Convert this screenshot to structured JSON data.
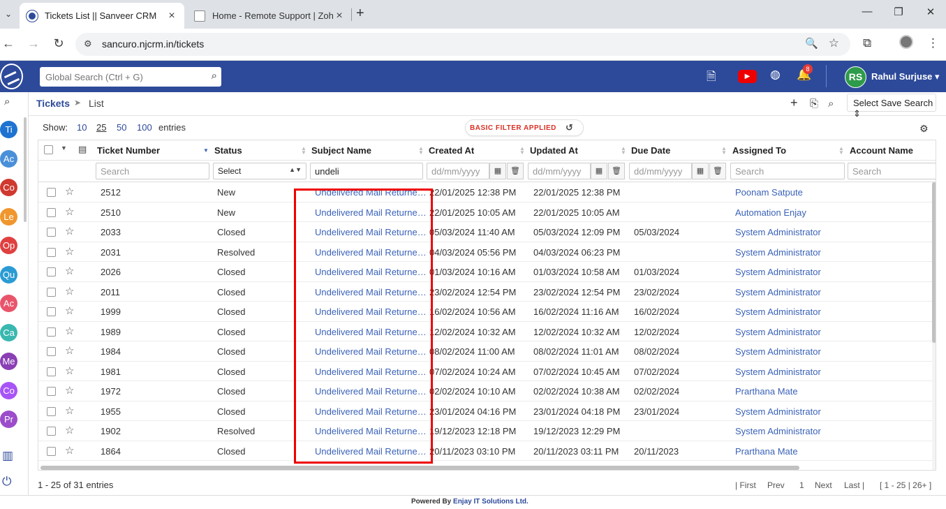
{
  "browser": {
    "tabs": [
      {
        "title": "Tickets List || Sanveer CRM",
        "active": true
      },
      {
        "title": "Home - Remote Support | Zoho",
        "active": false
      }
    ],
    "url": "sancuro.njcrm.in/tickets"
  },
  "header": {
    "search_placeholder": "Global Search (Ctrl + G)",
    "notification_count": "8",
    "youtube_label": "▶",
    "user_initials": "RS",
    "user_name": "Rahul Surjuse ▾"
  },
  "rail": {
    "modules": [
      {
        "abbr": "Ti",
        "color": "#1e73d1"
      },
      {
        "abbr": "Ac",
        "color": "#4a90d9"
      },
      {
        "abbr": "Co",
        "color": "#d0392f"
      },
      {
        "abbr": "Le",
        "color": "#f0962e"
      },
      {
        "abbr": "Op",
        "color": "#e04040"
      },
      {
        "abbr": "Qu",
        "color": "#2b9bd3"
      },
      {
        "abbr": "Ac",
        "color": "#e8556b"
      },
      {
        "abbr": "Ca",
        "color": "#3ab8b0"
      },
      {
        "abbr": "Me",
        "color": "#8a3fb5"
      },
      {
        "abbr": "Co",
        "color": "#a855f7"
      },
      {
        "abbr": "Pr",
        "color": "#9b4dca"
      }
    ]
  },
  "breadcrumb": {
    "module": "Tickets",
    "separator": "➤",
    "page": "List"
  },
  "toolbar": {
    "save_search": "Select Save Search",
    "show_label": "Show:",
    "page_sizes": [
      "10",
      "25",
      "50",
      "100"
    ],
    "selected_page_size": "25",
    "entries_label": "entries",
    "filter_badge": "BASIC FILTER APPLIED"
  },
  "table": {
    "columns": [
      "Ticket Number",
      "Status",
      "Subject Name",
      "Created At",
      "Updated At",
      "Due Date",
      "Assigned To",
      "Account Name"
    ],
    "filters": {
      "ticket_number": "Search",
      "status": "Select",
      "subject": "undeli",
      "created_at": "dd/mm/yyyy",
      "updated_at": "dd/mm/yyyy",
      "due_date": "dd/mm/yyyy",
      "assigned_to": "Search",
      "account_name": "Search"
    },
    "rows": [
      {
        "ticket": "2512",
        "status": "New",
        "subject": "Undelivered Mail Returned to Sender",
        "created": "22/01/2025 12:38 PM",
        "updated": "22/01/2025 12:38 PM",
        "due": "",
        "assigned": "Poonam Satpute"
      },
      {
        "ticket": "2510",
        "status": "New",
        "subject": "Undelivered Mail Returned to Sender",
        "created": "22/01/2025 10:05 AM",
        "updated": "22/01/2025 10:05 AM",
        "due": "",
        "assigned": "Automation Enjay"
      },
      {
        "ticket": "2033",
        "status": "Closed",
        "subject": "Undelivered Mail Returned to Sender",
        "created": "05/03/2024 11:40 AM",
        "updated": "05/03/2024 12:09 PM",
        "due": "05/03/2024",
        "assigned": "System Administrator"
      },
      {
        "ticket": "2031",
        "status": "Resolved",
        "subject": "Undelivered Mail Returned to Sender",
        "created": "04/03/2024 05:56 PM",
        "updated": "04/03/2024 06:23 PM",
        "due": "",
        "assigned": "System Administrator"
      },
      {
        "ticket": "2026",
        "status": "Closed",
        "subject": "Undelivered Mail Returned to Sender",
        "created": "01/03/2024 10:16 AM",
        "updated": "01/03/2024 10:58 AM",
        "due": "01/03/2024",
        "assigned": "System Administrator"
      },
      {
        "ticket": "2011",
        "status": "Closed",
        "subject": "Undelivered Mail Returned to Sender",
        "created": "23/02/2024 12:54 PM",
        "updated": "23/02/2024 12:54 PM",
        "due": "23/02/2024",
        "assigned": "System Administrator"
      },
      {
        "ticket": "1999",
        "status": "Closed",
        "subject": "Undelivered Mail Returned to Sender",
        "created": "16/02/2024 10:56 AM",
        "updated": "16/02/2024 11:16 AM",
        "due": "16/02/2024",
        "assigned": "System Administrator"
      },
      {
        "ticket": "1989",
        "status": "Closed",
        "subject": "Undelivered Mail Returned to Sender",
        "created": "12/02/2024 10:32 AM",
        "updated": "12/02/2024 10:32 AM",
        "due": "12/02/2024",
        "assigned": "System Administrator"
      },
      {
        "ticket": "1984",
        "status": "Closed",
        "subject": "Undelivered Mail Returned to Sender",
        "created": "08/02/2024 11:00 AM",
        "updated": "08/02/2024 11:01 AM",
        "due": "08/02/2024",
        "assigned": "System Administrator"
      },
      {
        "ticket": "1981",
        "status": "Closed",
        "subject": "Undelivered Mail Returned to Sender",
        "created": "07/02/2024 10:24 AM",
        "updated": "07/02/2024 10:45 AM",
        "due": "07/02/2024",
        "assigned": "System Administrator"
      },
      {
        "ticket": "1972",
        "status": "Closed",
        "subject": "Undelivered Mail Returned to Sender",
        "created": "02/02/2024 10:10 AM",
        "updated": "02/02/2024 10:38 AM",
        "due": "02/02/2024",
        "assigned": "Prarthana Mate"
      },
      {
        "ticket": "1955",
        "status": "Closed",
        "subject": "Undelivered Mail Returned to Sender",
        "created": "23/01/2024 04:16 PM",
        "updated": "23/01/2024 04:18 PM",
        "due": "23/01/2024",
        "assigned": "System Administrator"
      },
      {
        "ticket": "1902",
        "status": "Resolved",
        "subject": "Undelivered Mail Returned to Sender",
        "created": "19/12/2023 12:18 PM",
        "updated": "19/12/2023 12:29 PM",
        "due": "",
        "assigned": "System Administrator"
      },
      {
        "ticket": "1864",
        "status": "Closed",
        "subject": "Undelivered Mail Returned to Sender",
        "created": "20/11/2023 03:10 PM",
        "updated": "20/11/2023 03:11 PM",
        "due": "20/11/2023",
        "assigned": "Prarthana Mate"
      }
    ]
  },
  "footer": {
    "summary": "1 - 25 of 31 entries",
    "first": "| First",
    "prev": "Prev",
    "page": "1",
    "next": "Next",
    "last": "Last |",
    "range": "[ 1 - 25 | 26+ ]",
    "powered_prefix": "Powered By",
    "powered_brand": "Enjay IT Solutions Ltd."
  }
}
